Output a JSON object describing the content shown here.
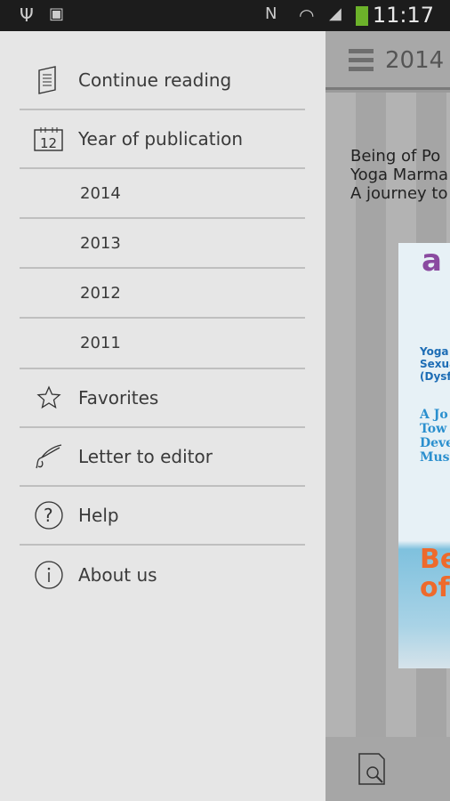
{
  "status": {
    "time": "11:17"
  },
  "appbar": {
    "title": "2014"
  },
  "main": {
    "titles": [
      "Being of Po",
      "Yoga Marma",
      "A journey to"
    ],
    "cover": {
      "logo": "a",
      "lines1": [
        "Yoga",
        "Sexua",
        "(Dysf"
      ],
      "lines2": [
        "A Jo",
        "Tow",
        "Deve",
        "Mus"
      ],
      "lines3": [
        "Be",
        "of"
      ]
    }
  },
  "drawer": {
    "items": [
      {
        "label": "Continue reading",
        "icon": "document-icon"
      },
      {
        "label": "Year of publication",
        "icon": "calendar-icon",
        "icon_text": "12"
      },
      {
        "label": "2014"
      },
      {
        "label": "2013"
      },
      {
        "label": "2012"
      },
      {
        "label": "2011"
      },
      {
        "label": "Favorites",
        "icon": "star-icon"
      },
      {
        "label": "Letter to editor",
        "icon": "quill-icon"
      },
      {
        "label": "Help",
        "icon": "help-icon"
      },
      {
        "label": "About us",
        "icon": "info-icon"
      }
    ]
  }
}
